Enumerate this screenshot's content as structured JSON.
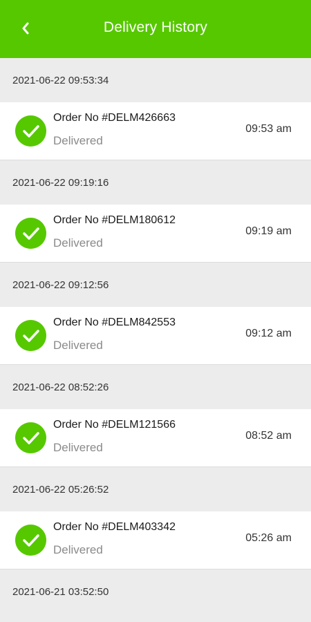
{
  "header": {
    "title": "Delivery History",
    "back_icon": "chevron-left-icon",
    "color": "#56c800"
  },
  "groups": [
    {
      "datetime": "2021-06-22 09:53:34",
      "order_no": "Order No #DELM426663",
      "status": "Delivered",
      "time": "09:53 am"
    },
    {
      "datetime": "2021-06-22 09:19:16",
      "order_no": "Order No #DELM180612",
      "status": "Delivered",
      "time": "09:19 am"
    },
    {
      "datetime": "2021-06-22 09:12:56",
      "order_no": "Order No #DELM842553",
      "status": "Delivered",
      "time": "09:12 am"
    },
    {
      "datetime": "2021-06-22 08:52:26",
      "order_no": "Order No #DELM121566",
      "status": "Delivered",
      "time": "08:52 am"
    },
    {
      "datetime": "2021-06-22 05:26:52",
      "order_no": "Order No #DELM403342",
      "status": "Delivered",
      "time": "05:26 am"
    }
  ],
  "trailing_date": "2021-06-21 03:52:50"
}
